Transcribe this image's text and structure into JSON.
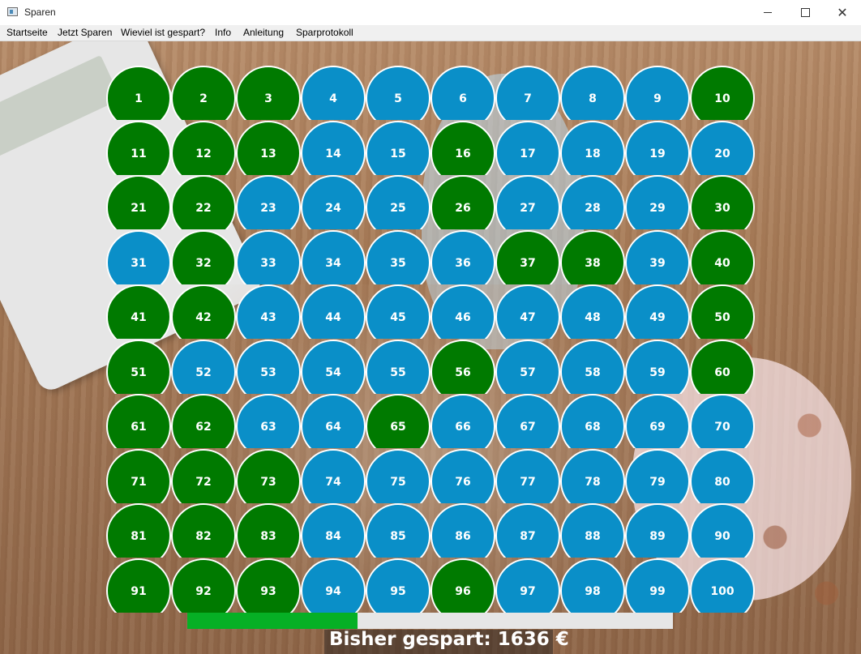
{
  "window": {
    "title": "Sparen",
    "controls": {
      "minimize_icon": "minimize-icon",
      "maximize_icon": "maximize-icon",
      "close_icon": "close-icon"
    }
  },
  "menu": {
    "items": [
      "Startseite",
      "Jetzt Sparen",
      "Wieviel ist gespart?",
      "Info",
      "Anleitung",
      "Sparprotokoll"
    ]
  },
  "colors": {
    "saved": "#007a00",
    "open": "#0a8fc8",
    "progress": "#06b025",
    "track": "#e6e6e6"
  },
  "grid": {
    "numbers": [
      1,
      2,
      3,
      4,
      5,
      6,
      7,
      8,
      9,
      10,
      11,
      12,
      13,
      14,
      15,
      16,
      17,
      18,
      19,
      20,
      21,
      22,
      23,
      24,
      25,
      26,
      27,
      28,
      29,
      30,
      31,
      32,
      33,
      34,
      35,
      36,
      37,
      38,
      39,
      40,
      41,
      42,
      43,
      44,
      45,
      46,
      47,
      48,
      49,
      50,
      51,
      52,
      53,
      54,
      55,
      56,
      57,
      58,
      59,
      60,
      61,
      62,
      63,
      64,
      65,
      66,
      67,
      68,
      69,
      70,
      71,
      72,
      73,
      74,
      75,
      76,
      77,
      78,
      79,
      80,
      81,
      82,
      83,
      84,
      85,
      86,
      87,
      88,
      89,
      90,
      91,
      92,
      93,
      94,
      95,
      96,
      97,
      98,
      99,
      100
    ],
    "saved": [
      1,
      2,
      3,
      10,
      11,
      12,
      13,
      16,
      21,
      22,
      26,
      30,
      32,
      37,
      38,
      40,
      41,
      42,
      50,
      51,
      56,
      60,
      61,
      62,
      65,
      71,
      72,
      73,
      81,
      82,
      83,
      91,
      92,
      93,
      96
    ]
  },
  "progress": {
    "fraction": 0.35
  },
  "footer": {
    "total_label": "Bisher gespart: 1636 €"
  }
}
